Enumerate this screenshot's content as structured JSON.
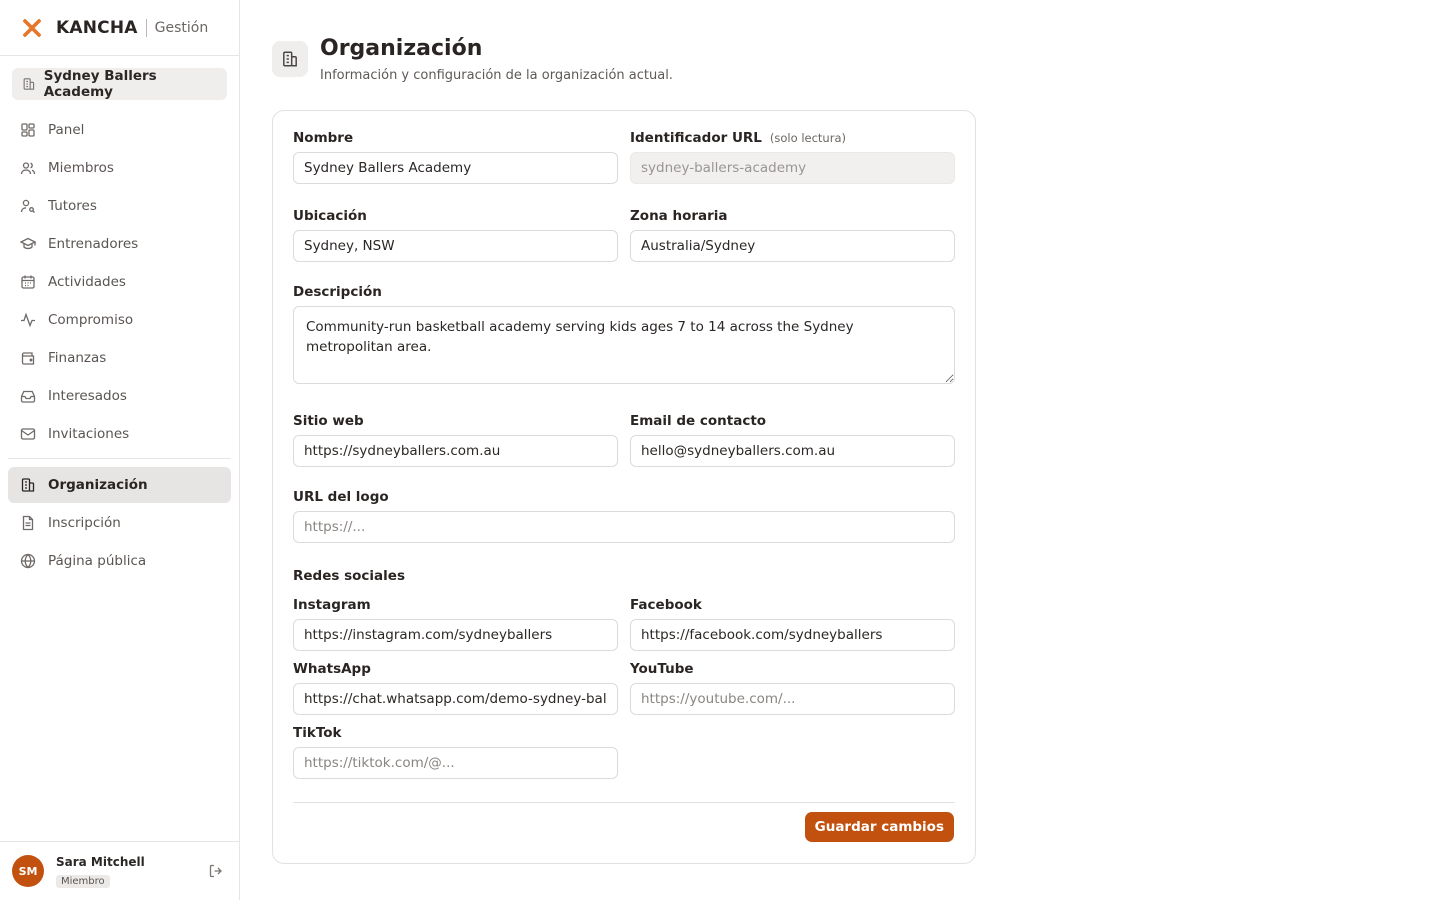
{
  "brand": {
    "name": "KANCHA",
    "sub": "Gestión",
    "accent": "#e8752a"
  },
  "sidebar": {
    "org": "Sydney Ballers Academy",
    "items": [
      {
        "label": "Panel",
        "icon": "dashboard-icon"
      },
      {
        "label": "Miembros",
        "icon": "users-icon"
      },
      {
        "label": "Tutores",
        "icon": "user-key-icon"
      },
      {
        "label": "Entrenadores",
        "icon": "graduation-cap-icon"
      },
      {
        "label": "Actividades",
        "icon": "calendar-icon"
      },
      {
        "label": "Compromiso",
        "icon": "activity-icon"
      },
      {
        "label": "Finanzas",
        "icon": "wallet-icon"
      },
      {
        "label": "Interesados",
        "icon": "inbox-icon"
      },
      {
        "label": "Invitaciones",
        "icon": "mail-icon"
      }
    ],
    "items2": [
      {
        "label": "Organización",
        "icon": "building-icon",
        "active": true
      },
      {
        "label": "Inscripción",
        "icon": "file-icon"
      },
      {
        "label": "Página pública",
        "icon": "globe-icon"
      }
    ]
  },
  "user": {
    "initials": "SM",
    "name": "Sara Mitchell",
    "role": "Miembro"
  },
  "page": {
    "title": "Organización",
    "subtitle": "Información y configuración de la organización actual."
  },
  "form": {
    "name_label": "Nombre",
    "name_value": "Sydney Ballers Academy",
    "slug_label": "Identificador URL",
    "slug_note": "(solo lectura)",
    "slug_value": "sydney-ballers-academy",
    "location_label": "Ubicación",
    "location_value": "Sydney, NSW",
    "timezone_label": "Zona horaria",
    "timezone_value": "Australia/Sydney",
    "description_label": "Descripción",
    "description_value": "Community-run basketball academy serving kids ages 7 to 14 across the Sydney metropolitan area.",
    "website_label": "Sitio web",
    "website_value": "https://sydneyballers.com.au",
    "email_label": "Email de contacto",
    "email_value": "hello@sydneyballers.com.au",
    "logo_label": "URL del logo",
    "logo_placeholder": "https://...",
    "social_title": "Redes sociales",
    "instagram_label": "Instagram",
    "instagram_value": "https://instagram.com/sydneyballers",
    "facebook_label": "Facebook",
    "facebook_value": "https://facebook.com/sydneyballers",
    "whatsapp_label": "WhatsApp",
    "whatsapp_value": "https://chat.whatsapp.com/demo-sydney-ballers",
    "youtube_label": "YouTube",
    "youtube_placeholder": "https://youtube.com/...",
    "tiktok_label": "TikTok",
    "tiktok_placeholder": "https://tiktok.com/@...",
    "save_label": "Guardar cambios"
  }
}
